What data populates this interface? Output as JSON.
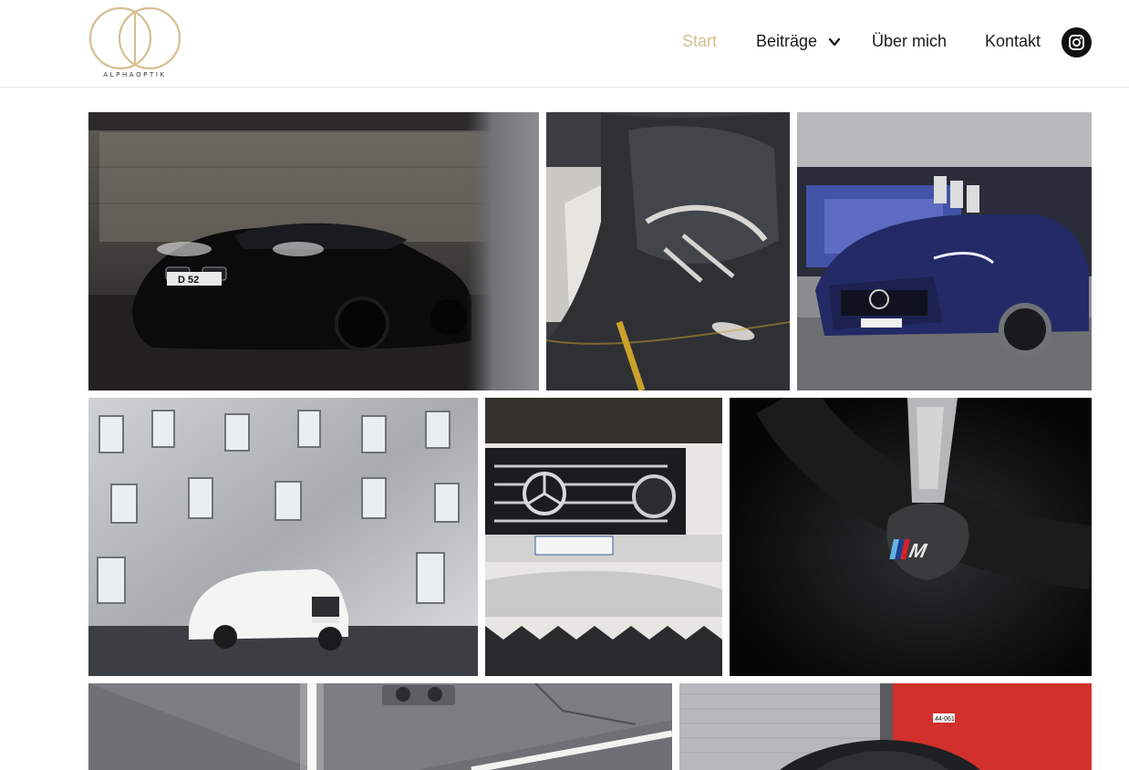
{
  "brand": {
    "logo_text": "ALPHAOPTIK",
    "gold": "#d6bf90"
  },
  "nav": {
    "items": [
      {
        "label": "Start",
        "active": true
      },
      {
        "label": "Beiträge",
        "has_dropdown": true
      },
      {
        "label": "Über mich"
      },
      {
        "label": "Kontakt"
      }
    ],
    "instagram_icon": "instagram-icon"
  },
  "gallery": {
    "photos": [
      {
        "name": "bmw-6-gran-coupe-black-in-garage"
      },
      {
        "name": "amg-seat-interior-yellow-stitching"
      },
      {
        "name": "mercedes-amg-e63-blue-showroom"
      },
      {
        "name": "mercedes-gle-white-gehry-building"
      },
      {
        "name": "mercedes-g-class-white-grille"
      },
      {
        "name": "bmw-m-steering-wheel-detail"
      },
      {
        "name": "parking-garage-ceiling-lights"
      },
      {
        "name": "car-front-red-wall"
      }
    ],
    "plate_text": "D 52",
    "wall_sign": "44-061"
  }
}
